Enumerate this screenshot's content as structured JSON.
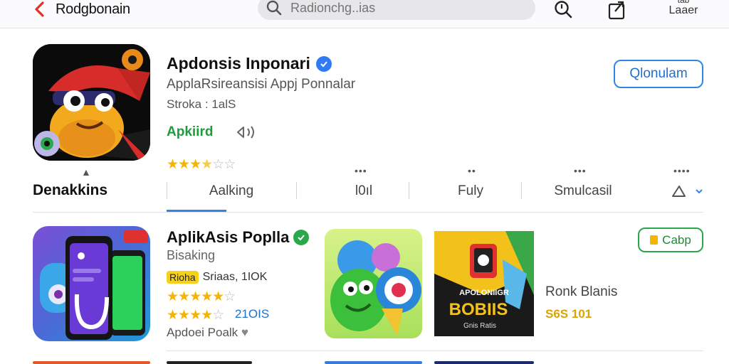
{
  "topbar": {
    "back_label": "Rodgbonain",
    "search_placeholder": "Radionchg..ias",
    "more_small": "tab",
    "more_label": "Laaer"
  },
  "featured": {
    "title": "Apdonsis Inponari",
    "subtitle": "ApplaRsireansisi Appj Ponnalar",
    "meta": "Stroka : 1alS",
    "install_label": "Apkiird",
    "get_button": "Qlonulam",
    "rating": {
      "on": "★★★",
      "half": "★",
      "off": "☆☆"
    }
  },
  "tabs_section": {
    "title": "Denakkins",
    "tabs": [
      {
        "label": "Aalking",
        "dots": ""
      },
      {
        "label": "l0ıl",
        "dots": "•••"
      },
      {
        "label": "Fuly",
        "dots": "••"
      },
      {
        "label": "Smulcasil",
        "dots": "•••"
      }
    ],
    "last_dots": "••••"
  },
  "list_item": {
    "title": "AplikAsis Poplla",
    "subtitle": "Bisaking",
    "tag": "Rioha",
    "tag_text": "Sriaas, 1IOK",
    "rating_a": {
      "on": "★★★★★",
      "off": "☆"
    },
    "rating_b": {
      "on": "★★★★",
      "off": "☆"
    },
    "rating_count": "21OIS",
    "developer": "Apdoei Poalk",
    "heart": "♥",
    "buy_button": "Cabp",
    "side_title": "Ronk Blanis",
    "side_price": "S6S 101",
    "shot2": {
      "line1": "APOLONIIGR",
      "line2": "BOBIIS",
      "line3": "Gnis Ratis"
    }
  },
  "colors": {
    "accent_blue": "#2f86e8",
    "accent_green": "#29a84a",
    "star": "#f4b400",
    "back_red": "#e0302a"
  }
}
